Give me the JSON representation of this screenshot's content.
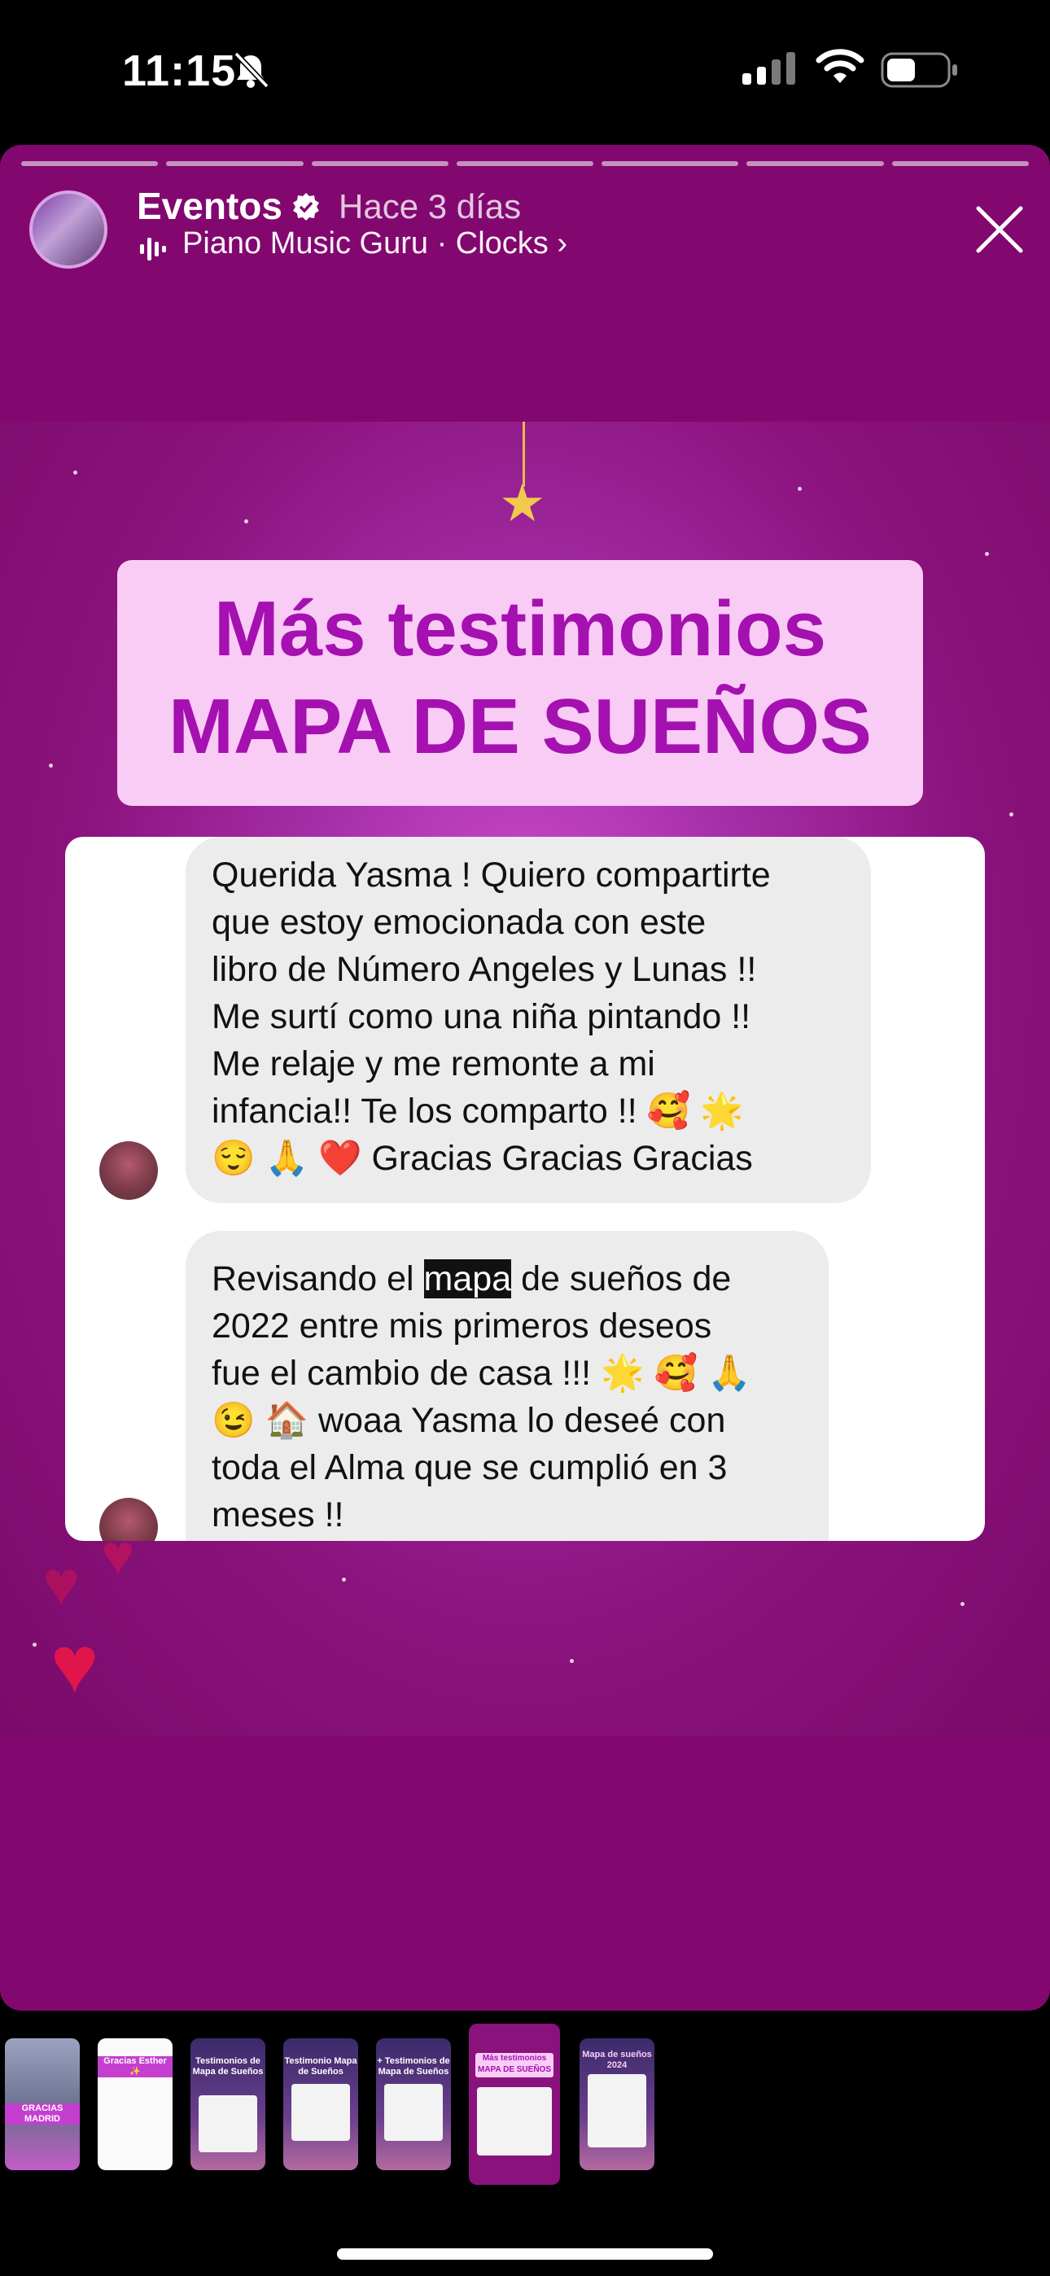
{
  "status_bar": {
    "time": "11:15"
  },
  "story": {
    "account_name": "Eventos",
    "time_ago": "Hace 3 días",
    "music": "Piano Music Guru · Clocks ›",
    "segments": 7,
    "current_index": 6
  },
  "post": {
    "title_line1": "Más testimonios",
    "title_line2": "MAPA DE SUEÑOS",
    "messages": [
      {
        "text": "Querida Yasma ! Quiero compartirte\nque estoy emocionada con este\nlibro de  Número Angeles  y Lunas !!\nMe surtí como una niña pintando !!\nMe relaje y me remonte a mi\ninfancia!! Te los comparto !! 🥰 🌟\n😌 🙏 ❤️ Gracias Gracias Gracias"
      },
      {
        "text_before": "Revisando el ",
        "highlight": "mapa",
        "text_after": " de sueños de\n2022 entre mis primeros deseos\nfue el cambio de casa !!! 🌟 🥰 🙏\n😉 🏠 woaa Yasma lo deseé con\ntoda el Alma  que se cumplió en 3\nmeses !!"
      }
    ]
  },
  "thumbnails": [
    {
      "caption": "GRACIAS MADRID"
    },
    {
      "caption": "Gracias Esther ✨"
    },
    {
      "caption": "Testimonios de Mapa de Sueños"
    },
    {
      "caption": "Testimonio Mapa de Sueños"
    },
    {
      "caption": "+ Testimonios de Mapa de Sueños"
    },
    {
      "caption": "Más testimonios MAPA DE SUEÑOS"
    },
    {
      "caption": "Mapa de sueños 2024"
    }
  ],
  "colors": {
    "story_bg": "#82086f",
    "title_box": "#f9ccf6",
    "title_text": "#a510b0"
  },
  "icons": [
    "bell-slash-icon",
    "signal-icon",
    "wifi-icon",
    "battery-icon",
    "verified-icon",
    "music-bars-icon",
    "close-icon",
    "star-icon",
    "heart-icon"
  ]
}
